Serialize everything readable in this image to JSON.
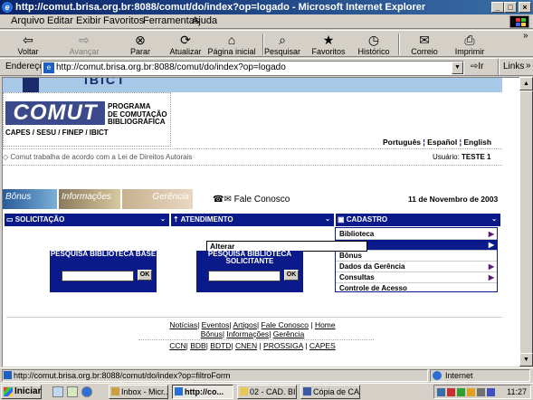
{
  "window": {
    "title": "http://comut.brisa.org.br:8088/comut/do/index?op=logado - Microsoft Internet Explorer",
    "minimize": "_",
    "maximize": "□",
    "close": "×"
  },
  "menu": [
    "Arquivo",
    "Editar",
    "Exibir",
    "Favoritos",
    "Ferramentas",
    "Ajuda"
  ],
  "toolbar": {
    "back": "Voltar",
    "forward": "Avançar",
    "stop": "Parar",
    "refresh": "Atualizar",
    "home": "Página inicial",
    "search": "Pesquisar",
    "favorites": "Favoritos",
    "history": "Histórico",
    "mail": "Correio",
    "print": "Imprimir",
    "more": "»"
  },
  "address": {
    "label": "Endereço",
    "url": "http://comut.brisa.org.br:8088/comut/do/index?op=logado",
    "go": "Ir",
    "links": "Links",
    "more": "»"
  },
  "page": {
    "logo_text": "COMUT",
    "program_lines": [
      "PROGRAMA",
      "DE COMUTAÇÃO",
      "BIBLIOGRÁFICA"
    ],
    "sponsors": "CAPES / SESU / FINEP / IBICT",
    "languages": [
      "Português",
      "Español",
      "English"
    ],
    "notice": "◇ Comut trabalha de acordo com a Lei de Direitos Autorais",
    "user_label": "Usuário:",
    "user_name": "TESTE 1",
    "image_buttons": [
      "Bônus",
      "Informações",
      "Gerência"
    ],
    "contact": "Fale Conosco",
    "date": "11 de Novembro de 2003",
    "nav": [
      {
        "label": "SOLICITAÇÃO"
      },
      {
        "label": "ATENDIMENTO"
      },
      {
        "label": "CADASTRO"
      }
    ],
    "submenu_item": "Alterar",
    "cadastro_menu": [
      {
        "label": "Biblioteca",
        "arrow": "▶"
      },
      {
        "label": "",
        "arrow": "▶"
      },
      {
        "label": "Bônus",
        "arrow": ""
      },
      {
        "label": "Dados da Gerência",
        "arrow": "▶"
      },
      {
        "label": "Consultas",
        "arrow": "▶"
      },
      {
        "label": "Controle de Acesso",
        "arrow": ""
      }
    ],
    "search_base": {
      "title": "PESQUISA BIBLIOTECA BASE",
      "ok": "OK",
      "value": ""
    },
    "search_solicitante": {
      "title": "PESQUISA BIBLIOTECA SOLICITANTE",
      "ok": "OK",
      "value": ""
    },
    "footer_links_1": [
      "Notícias",
      "Eventos",
      "Artigos",
      "Fale Conosco",
      "Home"
    ],
    "footer_links_2": [
      "Bônus",
      "Informações",
      "Gerência"
    ],
    "footer_links_3": [
      "CCN",
      "BDB",
      "BDTD",
      "CNEN",
      "PROSSIGA",
      "CAPES"
    ]
  },
  "status": {
    "text": "http://comut.brisa.org.br:8088/comut/do/index?op=filtroForm",
    "zone": "Internet"
  },
  "taskbar": {
    "start": "Iniciar",
    "tasks": [
      "Inbox - Micr...",
      "http://co...",
      "02 - CAD. BI...",
      "Cópia de CA..."
    ],
    "clock": "11:27"
  },
  "colors": {
    "nav_blue": "#0a1a8a",
    "title_blue": "#0a246a",
    "banner": "#a8c8e8"
  }
}
